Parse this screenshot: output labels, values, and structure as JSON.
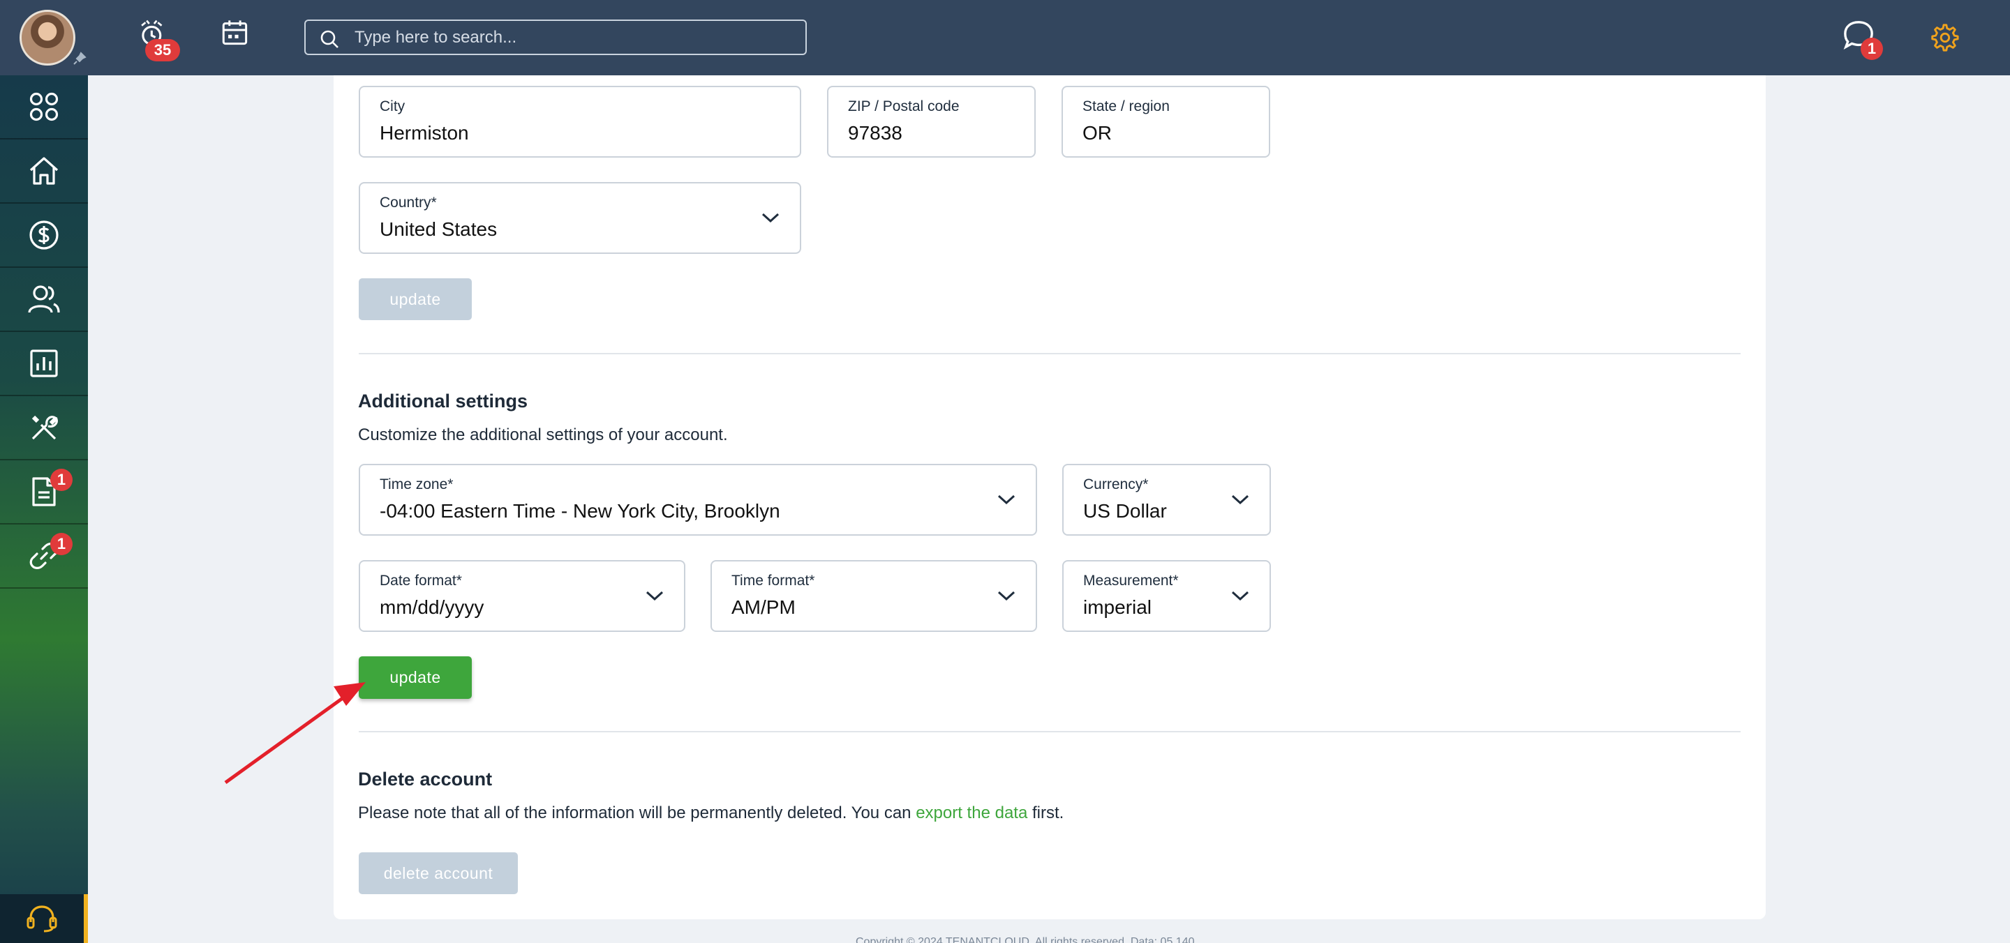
{
  "header": {
    "notifications_count": "35",
    "search_placeholder": "Type here to search...",
    "messages_count": "1"
  },
  "sidebar": {
    "items": [
      {
        "icon": "grid-icon"
      },
      {
        "icon": "home-icon"
      },
      {
        "icon": "dollar-icon"
      },
      {
        "icon": "users-icon"
      },
      {
        "icon": "chart-icon"
      },
      {
        "icon": "tools-icon"
      },
      {
        "icon": "document-icon",
        "badge": "1"
      },
      {
        "icon": "link-icon",
        "badge": "1"
      }
    ],
    "support_icon": "headset-icon"
  },
  "address": {
    "city_label": "City",
    "city_value": "Hermiston",
    "zip_label": "ZIP / Postal code",
    "zip_value": "97838",
    "state_label": "State / region",
    "state_value": "OR",
    "country_label": "Country*",
    "country_value": "United States",
    "update_label": "update"
  },
  "additional": {
    "title": "Additional settings",
    "description": "Customize the additional settings of your account.",
    "timezone_label": "Time zone*",
    "timezone_value": "-04:00 Eastern Time - New York City, Brooklyn",
    "currency_label": "Currency*",
    "currency_value": "US Dollar",
    "date_format_label": "Date format*",
    "date_format_value": "mm/dd/yyyy",
    "time_format_label": "Time format*",
    "time_format_value": "AM/PM",
    "measurement_label": "Measurement*",
    "measurement_value": "imperial",
    "update_label": "update"
  },
  "delete_account": {
    "title": "Delete account",
    "description_before": "Please note that all of the information will be permanently deleted. You can ",
    "link_text": "export the data",
    "description_after": " first.",
    "button_label": "delete account"
  },
  "footer": {
    "text": "Copyright © 2024 TENANTCLOUD. All rights reserved. Data: 05.140"
  },
  "colors": {
    "topbar": "#33465e",
    "accent_green": "#3ea63c",
    "badge_red": "#e03b3b",
    "annotation_arrow": "#e3202a"
  }
}
